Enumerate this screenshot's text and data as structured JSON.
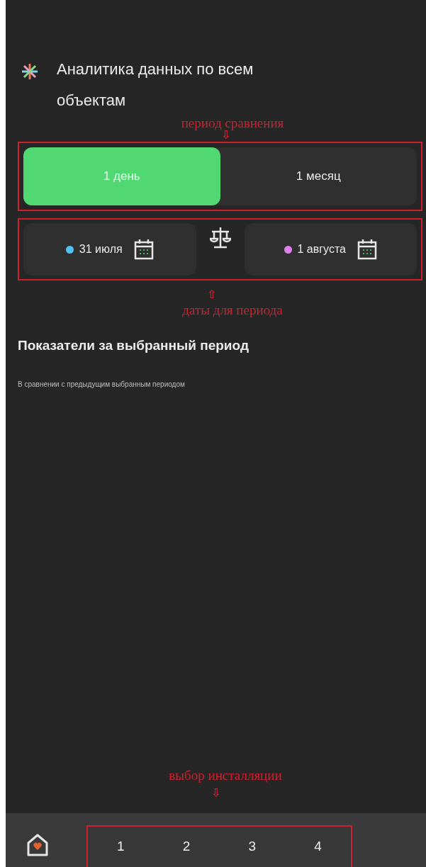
{
  "header": {
    "title": "Аналитика данных по всем объектам"
  },
  "period_tabs": [
    {
      "label": "1 день",
      "selected": true
    },
    {
      "label": "1 месяц",
      "selected": false
    }
  ],
  "dates": [
    {
      "label": "31 июля",
      "color": "#4fc3f7"
    },
    {
      "label": "1 августа",
      "color": "#e07ef0"
    }
  ],
  "section": {
    "title": "Показатели за выбранный период",
    "subtitle": "В сравнении с предыдущим выбранным периодом"
  },
  "bottom_nav": {
    "items": [
      "1",
      "2",
      "3",
      "4"
    ]
  },
  "annotations": [
    {
      "text": "период сравнения",
      "arrow": "⇩"
    },
    {
      "text": "даты для периода",
      "arrow": "⇧"
    },
    {
      "text": "выбор инсталляции",
      "arrow": "⇩"
    }
  ]
}
